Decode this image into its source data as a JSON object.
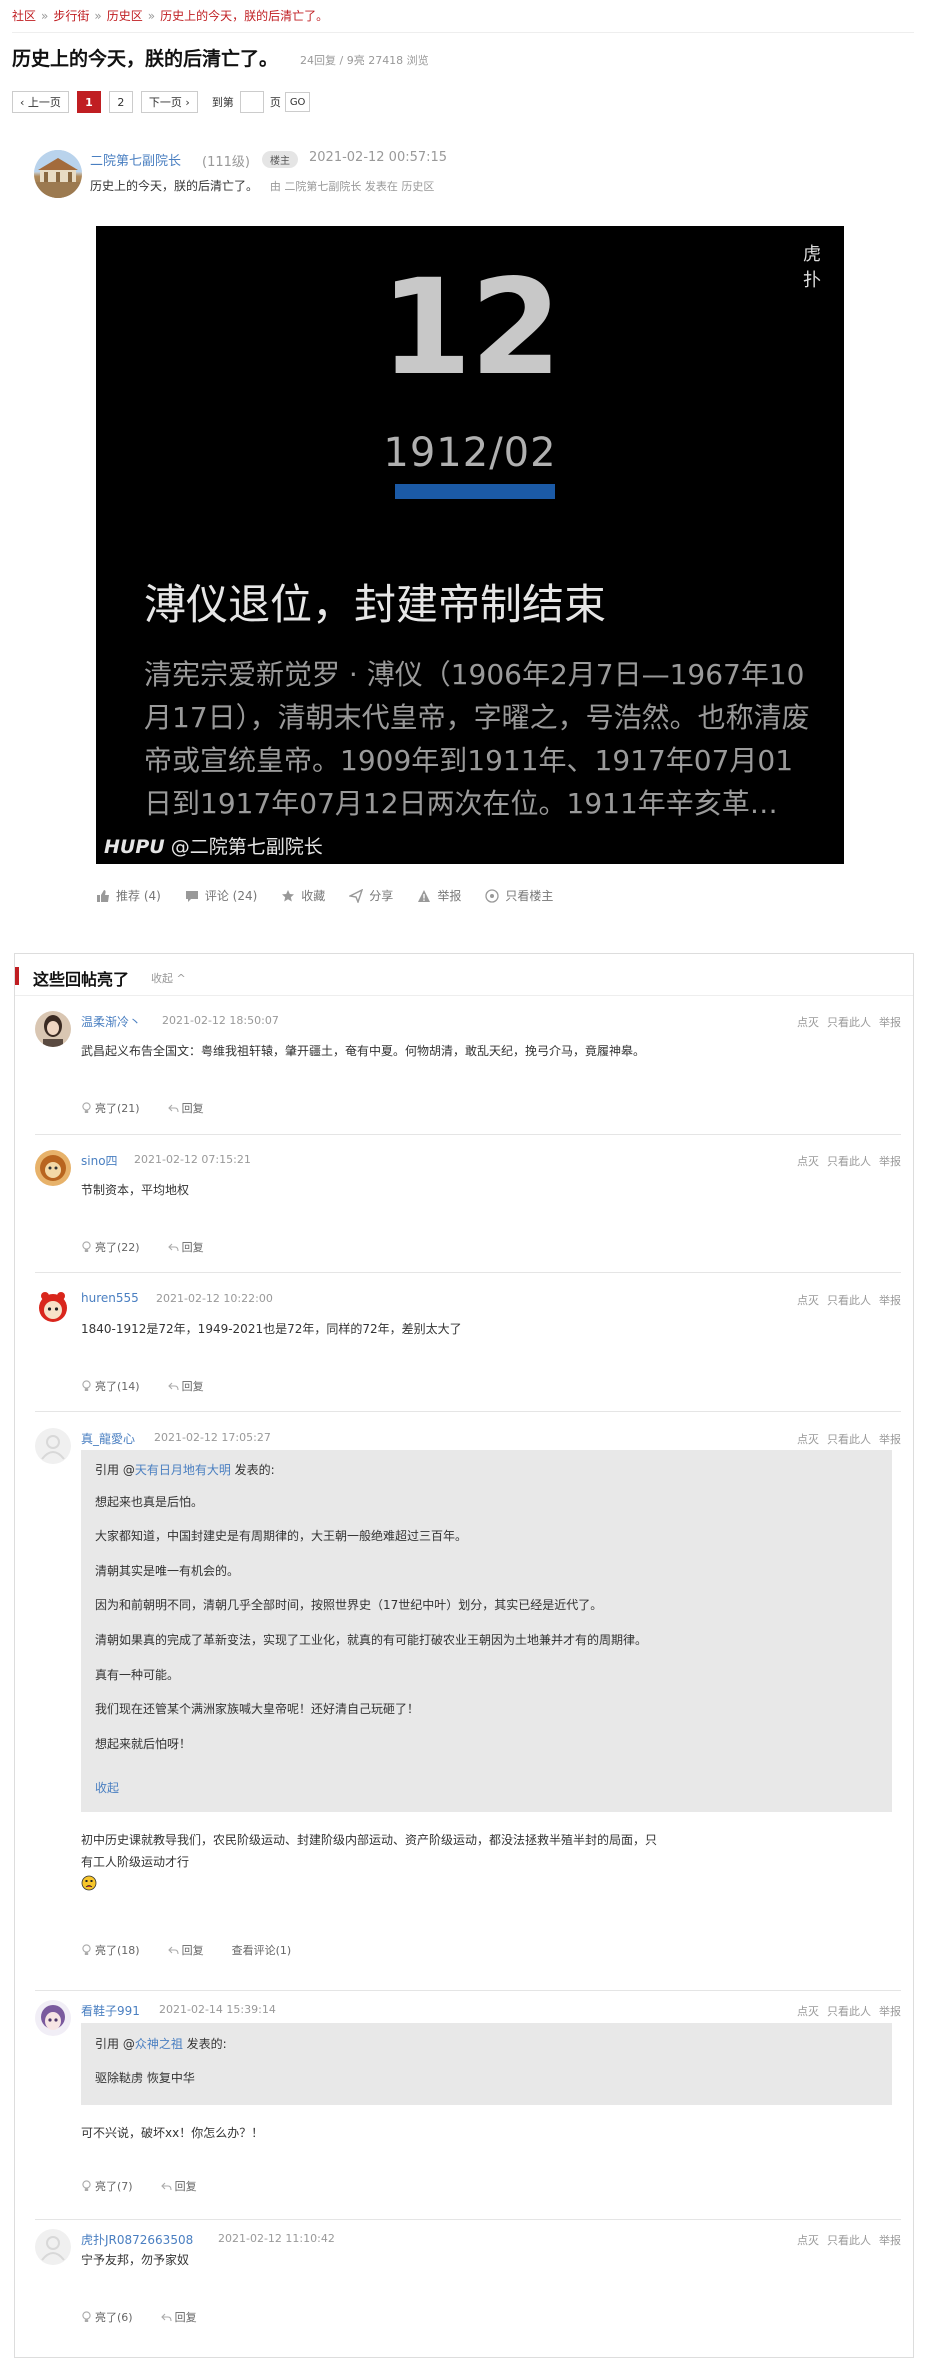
{
  "breadcrumb": [
    "社区",
    "步行街",
    "历史区",
    "历史上的今天，朕的后清亡了。"
  ],
  "thread": {
    "title": "历史上的今天，朕的后清亡了。",
    "stats": "24回复 / 9亮 27418 浏览"
  },
  "pager": {
    "prev": "‹ 上一页",
    "pages": [
      "1",
      "2"
    ],
    "next": "下一页 ›",
    "jump": "到第",
    "page_unit": "页",
    "go": "GO"
  },
  "op": {
    "name": "二院第七副院长",
    "level": "(111级)",
    "badge": "楼主",
    "time": "2021-02-12 00:57:15",
    "text": "历史上的今天，朕的后清亡了。",
    "meta_by": "由",
    "meta_author": "二院第七副院长",
    "meta_in": "发表在",
    "meta_board": "历史区"
  },
  "poster": {
    "day": "12",
    "date": "1912/02",
    "headline": "溥仪退位，封建帝制结束",
    "body": [
      "清宪宗爱新觉罗 · 溥仪（1906年2月7日—1967年10",
      "月17日），清朝末代皇帝，字曜之，号浩然。也称清废",
      "帝或宣统皇帝。1909年到1911年、1917年07月01",
      "日到1917年07月12日两次在位。1911年辛亥革…"
    ],
    "wm_brand": "HUPU",
    "wm_user": "@二院第七副院长",
    "logo": "虎扑",
    "bar_color": "#1b5aa6"
  },
  "actions": {
    "recommend": "推荐 (4)",
    "comment": "评论 (24)",
    "fav": "收藏",
    "share": "分享",
    "report": "举报",
    "only_op": "只看楼主"
  },
  "lit": {
    "title": "这些回帖亮了",
    "collapse": "收起 ^"
  },
  "reply_ops": {
    "dislike": "点灭",
    "only": "只看此人",
    "report": "举报"
  },
  "reply_action": "回复",
  "replies": [
    {
      "name": "温柔渐冷丶",
      "time": "2021-02-12 18:50:07",
      "text": "武昌起义布告全国文：粤维我祖轩辕，肇开疆土，奄有中夏。何物胡清，敢乱天纪，挽弓介马，竟履神皋。",
      "light": "亮了(21)"
    },
    {
      "name": "sino四",
      "time": "2021-02-12 07:15:21",
      "text": "节制资本，平均地权",
      "light": "亮了(22)"
    },
    {
      "name": "huren555",
      "time": "2021-02-12 10:22:00",
      "text": "1840-1912是72年，1949-2021也是72年，同样的72年，差别太大了",
      "light": "亮了(14)"
    },
    {
      "name": "真_龍愛心",
      "time": "2021-02-12 17:05:27",
      "quote_prefix": "引用 @",
      "quote_user": "天有日月地有大明",
      "quote_suffix": " 发表的:",
      "quote_lines": [
        "想起来也真是后怕。",
        "大家都知道，中国封建史是有周期律的，大王朝一般绝难超过三百年。",
        "清朝其实是唯一有机会的。",
        "因为和前朝明不同，清朝几乎全部时间，按照世界史（17世纪中叶）划分，其实已经是近代了。",
        "清朝如果真的完成了革新变法，实现了工业化，就真的有可能打破农业王朝因为土地兼并才有的周期律。",
        "真有一种可能。",
        "我们现在还管某个满洲家族喊大皇帝呢！还好清自己玩砸了！",
        "想起来就后怕呀！"
      ],
      "quote_collapse": "收起",
      "text1": "初中历史课就教导我们，农民阶级运动、封建阶级内部运动、资产阶级运动，都没法拯救半殖半封的局面，只",
      "text2": "有工人阶级运动才行",
      "light": "亮了(18)",
      "view_comments": "查看评论(1)"
    },
    {
      "name": "看鞋子991",
      "time": "2021-02-14 15:39:14",
      "quote_prefix": "引用 @",
      "quote_user": "众神之祖",
      "quote_suffix": " 发表的:",
      "quote_lines": [
        "驱除鞑虏 恢复中华"
      ],
      "text": "可不兴说，破坏xx！你怎么办？！",
      "light": "亮了(7)"
    },
    {
      "name": "虎扑JR0872663508",
      "time": "2021-02-12 11:10:42",
      "text": "宁予友邦，勿予家奴",
      "light": "亮了(6)"
    }
  ]
}
